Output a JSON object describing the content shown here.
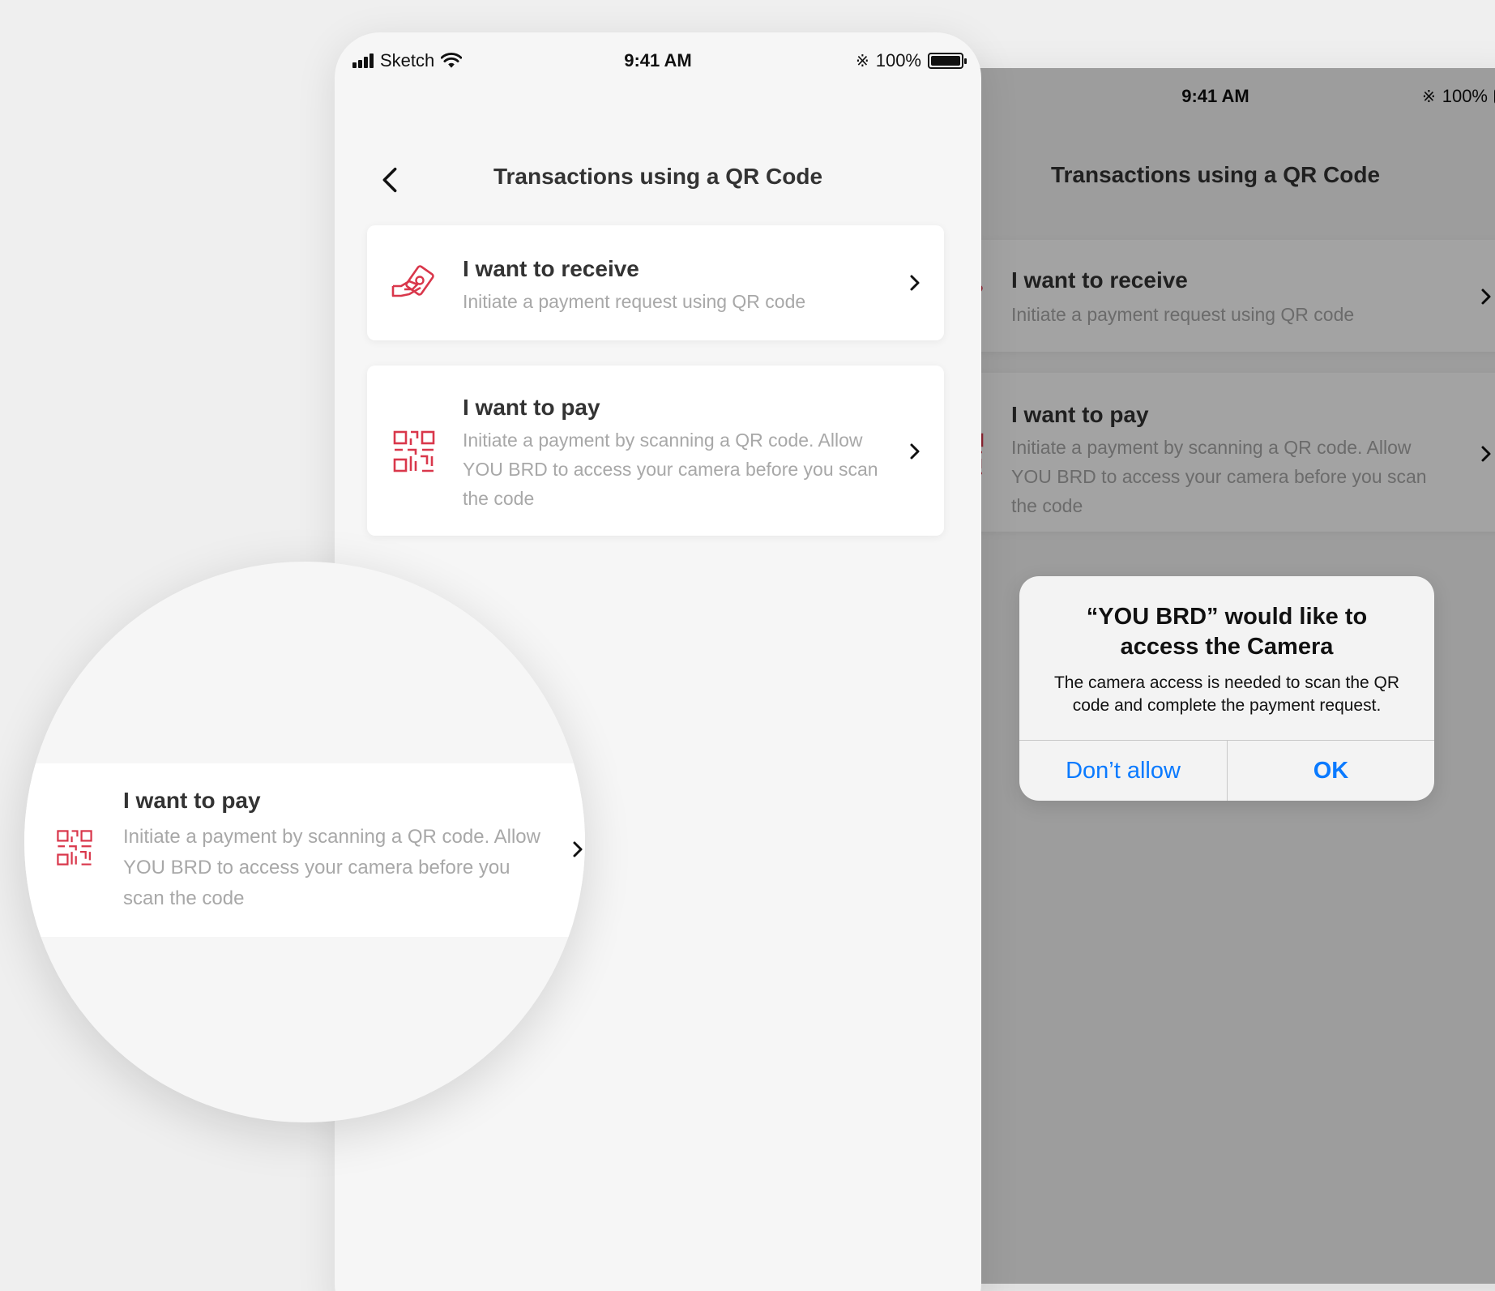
{
  "status_bar": {
    "carrier": "Sketch",
    "time": "9:41 AM",
    "battery": "100%"
  },
  "header": {
    "title": "Transactions using a QR Code"
  },
  "options": [
    {
      "title": "I want to receive",
      "description": "Initiate a payment request using QR code",
      "icon": "hand-money-icon"
    },
    {
      "title": "I want to pay",
      "description": "Initiate a payment by scanning a QR code. Allow YOU BRD to access your camera before you scan the code",
      "icon": "qr-code-icon"
    }
  ],
  "magnifier": {
    "title": "I want to pay",
    "description": "Initiate a payment by scanning a QR code. Allow YOU BRD to access your camera before you scan the code"
  },
  "alert": {
    "title": "“YOU BRD” would like to access the Camera",
    "message": "The camera access is needed to scan the QR code and complete the payment request.",
    "deny_label": "Don’t allow",
    "ok_label": "OK"
  },
  "colors": {
    "accent_red": "#d9374b",
    "ios_blue": "#0a7aff",
    "background": "#f6f6f6"
  }
}
